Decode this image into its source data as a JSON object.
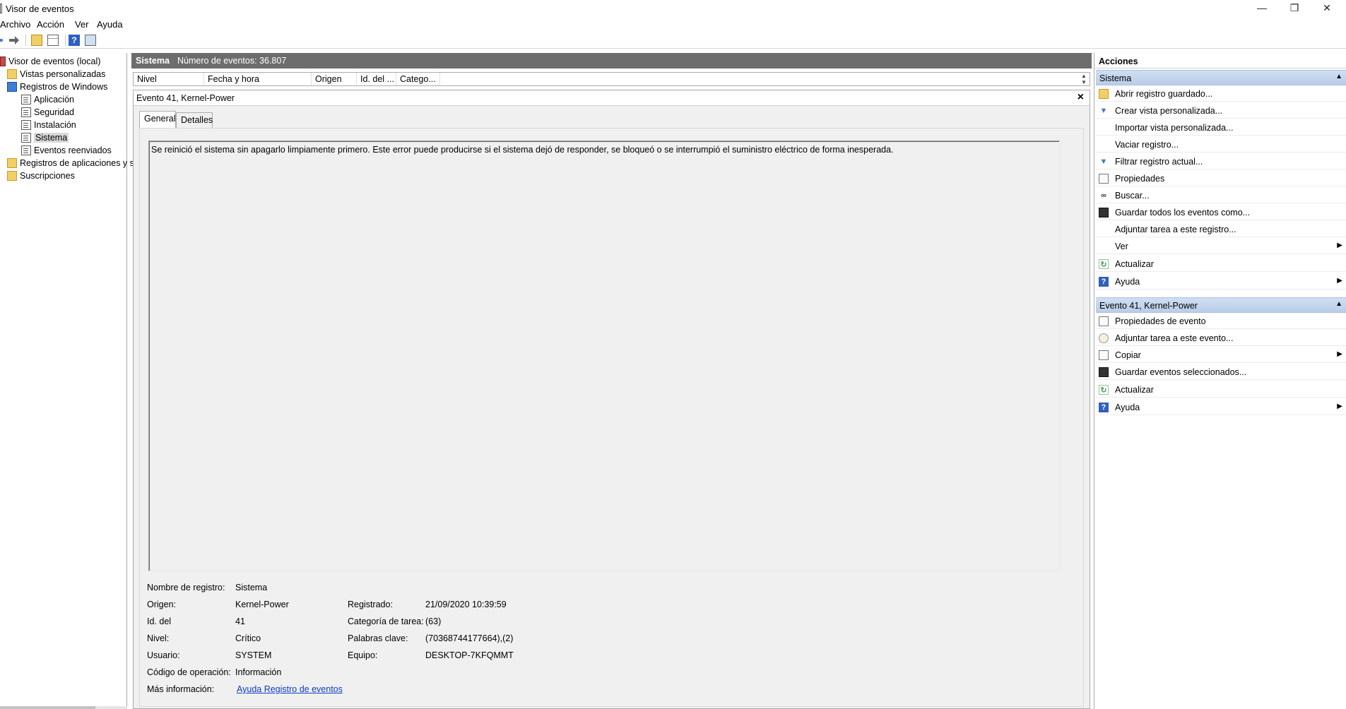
{
  "window": {
    "title": "Visor de eventos",
    "minimize": "—",
    "maximize": "❐",
    "close": "✕"
  },
  "menu": [
    "Archivo",
    "Acción",
    "Ver",
    "Ayuda"
  ],
  "tree": {
    "root": "Visor de eventos (local)",
    "custom_views": "Vistas personalizadas",
    "windows_logs": "Registros de Windows",
    "logs": [
      "Aplicación",
      "Seguridad",
      "Instalación",
      "Sistema",
      "Eventos reenviados"
    ],
    "app_logs": "Registros de aplicaciones y s",
    "subscriptions": "Suscripciones"
  },
  "center": {
    "log_name": "Sistema",
    "event_count": "Número de eventos: 36.807",
    "columns": [
      "Nivel",
      "Fecha y hora",
      "Origen",
      "Id. del ...",
      "Catego..."
    ],
    "event_title": "Evento 41, Kernel-Power",
    "tabs": [
      "General",
      "Detalles"
    ],
    "message": "Se reinició el sistema sin apagarlo limpiamente primero. Este error puede producirse si el sistema dejó de responder, se bloqueó o se interrumpió el suministro eléctrico de forma inesperada.",
    "props": {
      "log_name_label": "Nombre de registro:",
      "log_name_value": "Sistema",
      "source_label": "Origen:",
      "source_value": "Kernel-Power",
      "logged_label": "Registrado:",
      "logged_value": "21/09/2020 10:39:59",
      "id_label": "Id. del",
      "id_value": "41",
      "task_label": "Categoría de tarea:",
      "task_value": "(63)",
      "level_label": "Nivel:",
      "level_value": "Crítico",
      "keywords_label": "Palabras clave:",
      "keywords_value": "(70368744177664),(2)",
      "user_label": "Usuario:",
      "user_value": "SYSTEM",
      "computer_label": "Equipo:",
      "computer_value": "DESKTOP-7KFQMMT",
      "opcode_label": "Código de operación:",
      "opcode_value": "Información",
      "more_label": "Más información:",
      "more_link": "Ayuda Registro de eventos"
    }
  },
  "actions": {
    "title": "Acciones",
    "section1": "Sistema",
    "section1_items": [
      {
        "label": "Abrir registro guardado...",
        "icon": "folder-open-icon"
      },
      {
        "label": "Crear vista personalizada...",
        "icon": "filter-icon"
      },
      {
        "label": "Importar vista personalizada...",
        "icon": ""
      },
      {
        "label": "Vaciar registro...",
        "icon": ""
      },
      {
        "label": "Filtrar registro actual...",
        "icon": "filter-icon"
      },
      {
        "label": "Propiedades",
        "icon": "properties-icon"
      },
      {
        "label": "Buscar...",
        "icon": "find-icon"
      },
      {
        "label": "Guardar todos los eventos como...",
        "icon": "save-icon"
      },
      {
        "label": "Adjuntar tarea a este registro...",
        "icon": ""
      },
      {
        "label": "Ver",
        "icon": "",
        "submenu": true
      },
      {
        "label": "Actualizar",
        "icon": "refresh-icon"
      },
      {
        "label": "Ayuda",
        "icon": "help-icon",
        "submenu": true
      }
    ],
    "section2": "Evento 41, Kernel-Power",
    "section2_items": [
      {
        "label": "Propiedades de evento",
        "icon": "properties-icon"
      },
      {
        "label": "Adjuntar tarea a este evento...",
        "icon": "task-icon"
      },
      {
        "label": "Copiar",
        "icon": "copy-icon",
        "submenu": true
      },
      {
        "label": "Guardar eventos seleccionados...",
        "icon": "save-icon"
      },
      {
        "label": "Actualizar",
        "icon": "refresh-icon"
      },
      {
        "label": "Ayuda",
        "icon": "help-icon",
        "submenu": true
      }
    ]
  }
}
